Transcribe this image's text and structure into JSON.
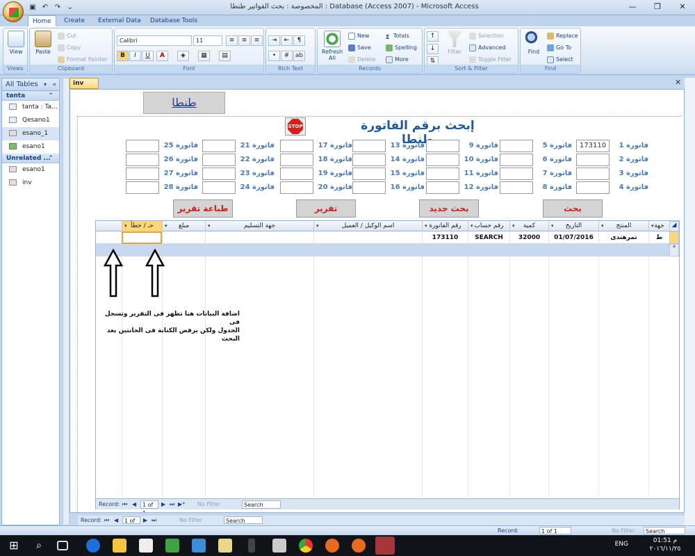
{
  "window": {
    "title": "المخصوصة : بحث الفواتير طنطا : Database (Access 2007) - Microsoft Access",
    "minimize": "—",
    "restore": "❐",
    "close": "✕"
  },
  "ribbon_tabs": [
    "Home",
    "Create",
    "External Data",
    "Database Tools"
  ],
  "ribbon": {
    "views": {
      "view": "View",
      "label": "Views"
    },
    "clipboard": {
      "paste": "Paste",
      "cut": "Cut",
      "copy": "Copy",
      "format_painter": "Format Painter",
      "label": "Clipboard"
    },
    "font": {
      "font_name": "Calibri",
      "font_size": "11",
      "bold": "B",
      "italic": "I",
      "underline": "U",
      "font_color": "A",
      "label": "Font"
    },
    "rich_text": {
      "label": "Rich Text"
    },
    "records": {
      "refresh": "Refresh All",
      "new": "New",
      "save": "Save",
      "delete": "Delete",
      "totals": "Totals",
      "spelling": "Spelling",
      "more": "More",
      "label": "Records"
    },
    "sort_filter": {
      "filter": "Filter",
      "selection": "Selection",
      "advanced": "Advanced",
      "toggle_filter": "Toggle Filter",
      "label": "Sort & Filter"
    },
    "find": {
      "find": "Find",
      "replace": "Replace",
      "goto": "Go To",
      "select": "Select",
      "label": "Find"
    }
  },
  "nav": {
    "header": "All Tables",
    "groups": [
      {
        "name": "tanta",
        "items": [
          "tanta : Ta...",
          "Qesano1",
          "esano_1",
          "esano1"
        ]
      },
      {
        "name": "Unrelated ...",
        "items": [
          "esano1",
          "inv"
        ]
      }
    ]
  },
  "doc_tab": "inv",
  "form": {
    "brand": "طنطا",
    "title": "إبحث برقم الفاتورة طنطا",
    "stop": "STOP",
    "invoices": [
      {
        "label": "فاتورة 1",
        "value": "173110"
      },
      {
        "label": "فاتورة 5",
        "value": ""
      },
      {
        "label": "فاتورة 9",
        "value": ""
      },
      {
        "label": "فاتورة 13",
        "value": ""
      },
      {
        "label": "فاتورة 17",
        "value": ""
      },
      {
        "label": "فاتورة 21",
        "value": ""
      },
      {
        "label": "فاتورة 25",
        "value": ""
      },
      {
        "label": "فاتورة 2",
        "value": ""
      },
      {
        "label": "فاتورة 6",
        "value": ""
      },
      {
        "label": "فاتورة 10",
        "value": ""
      },
      {
        "label": "فاتورة 14",
        "value": ""
      },
      {
        "label": "فاتورة 18",
        "value": ""
      },
      {
        "label": "فاتورة 22",
        "value": ""
      },
      {
        "label": "فاتورة 26",
        "value": ""
      },
      {
        "label": "فاتورة 3",
        "value": ""
      },
      {
        "label": "فاتورة 7",
        "value": ""
      },
      {
        "label": "فاتورة 11",
        "value": ""
      },
      {
        "label": "فاتورة 15",
        "value": ""
      },
      {
        "label": "فاتورة 19",
        "value": ""
      },
      {
        "label": "فاتورة 23",
        "value": ""
      },
      {
        "label": "فاتورة 27",
        "value": ""
      },
      {
        "label": "فاتورة 4",
        "value": ""
      },
      {
        "label": "فاتورة 8",
        "value": ""
      },
      {
        "label": "فاتورة 12",
        "value": ""
      },
      {
        "label": "فاتورة 16",
        "value": ""
      },
      {
        "label": "فاتورة 20",
        "value": ""
      },
      {
        "label": "فاتورة 24",
        "value": ""
      },
      {
        "label": "فاتورة 28",
        "value": ""
      }
    ],
    "buttons": {
      "search": "بحث",
      "new_search": "بحث جديد",
      "report": "تقرير",
      "print_report": "طباعة تقرير"
    }
  },
  "grid": {
    "columns": [
      "جهة",
      "المنتج",
      "التاريخ",
      "كمية",
      "رقم حساب",
      "رقم الفاتورة",
      "اسم الوكيل / العميل",
      "جهة التسليم",
      "مبلغ",
      "حـ / خطأ"
    ],
    "row": [
      "ط",
      "تمرهندى",
      "01/07/2016",
      "32000",
      "SEARCH",
      "173110",
      "",
      "",
      "",
      ""
    ],
    "new_row_marker": "*"
  },
  "subform_nav": {
    "record_label": "Record:",
    "position": "1 of 1",
    "no_filter": "No Filter",
    "search": "Search"
  },
  "annotation": {
    "line1": "اضافة البيانات هنا تظهر فى التقرير وتسجل فى",
    "line2": "الجدول ولكن يرفض الكتابة فى الخانتين بعد البحث"
  },
  "form_nav": {
    "record_label": "Record:",
    "position": "1 of 1",
    "no_filter": "No Filter",
    "search": "Search"
  },
  "status": {
    "record_label": "Record:",
    "position": "1 of 1",
    "no_filter": "No Filter",
    "search": "Search"
  },
  "taskbar": {
    "lang": "ENG",
    "time": "01:51 م",
    "date": "٢٠١٦/١١/٢٥"
  }
}
